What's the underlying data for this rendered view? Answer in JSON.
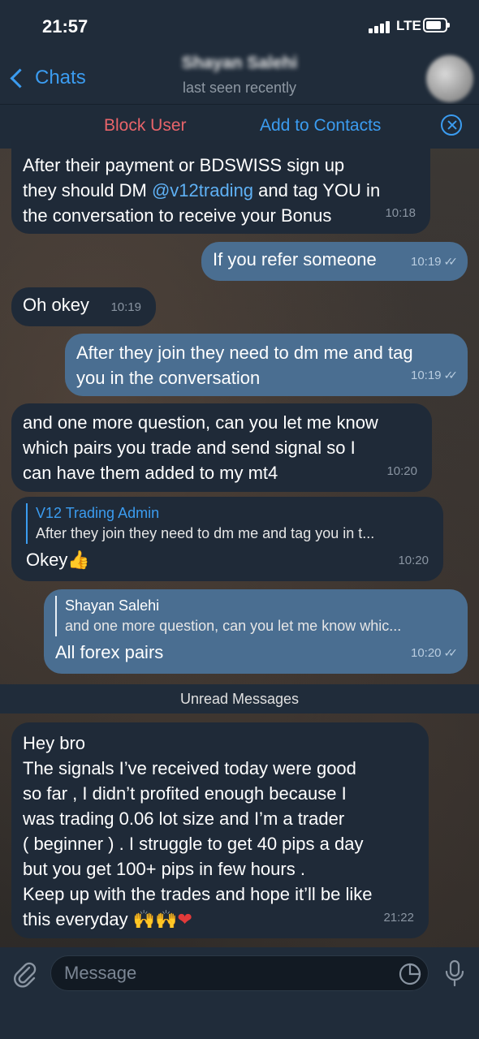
{
  "status_bar": {
    "time": "21:57",
    "network": "LTE"
  },
  "nav": {
    "back_label": "Chats",
    "contact_name": "Shayan Salehi",
    "last_seen": "last seen recently"
  },
  "action_bar": {
    "block_label": "Block User",
    "add_label": "Add to Contacts"
  },
  "messages": [
    {
      "dir": "in",
      "text_before": "After their payment or BDSWISS sign up\nthey should DM ",
      "link": "@v12trading",
      "text_after": " and tag YOU in\nthe conversation to receive your Bonus",
      "time": "10:18"
    },
    {
      "dir": "out",
      "text": "If you refer someone",
      "time": "10:19"
    },
    {
      "dir": "in",
      "text": "Oh okey",
      "time": "10:19"
    },
    {
      "dir": "out",
      "text": "After they join they need to dm me and tag\nyou in the conversation",
      "time": "10:19"
    },
    {
      "dir": "in",
      "text": "and one more question, can you let me know\nwhich pairs you trade and send signal so I\ncan have them added to my mt4",
      "time": "10:20"
    },
    {
      "dir": "in",
      "reply_name": "V12 Trading Admin",
      "reply_text": "After they join they need to dm me and tag you in t...",
      "text": "Okey",
      "emoji": "👍",
      "time": "10:20"
    },
    {
      "dir": "out",
      "reply_name": "Shayan Salehi",
      "reply_text": "and one more question, can you let me know whic...",
      "text": "All forex pairs",
      "time": "10:20"
    },
    {
      "dir": "in",
      "text": "Hey bro\nThe signals I’ve received today were good\nso far , I didn’t profited enough because I\nwas trading 0.06 lot size and I’m a trader\n( beginner ) . I struggle to get 40 pips a day\nbut you get 100+ pips in few hours .\nKeep up with the trades and hope it’ll be like\nthis everyday ",
      "emoji": "🙌🙌",
      "emoji2": "❤",
      "time": "21:22"
    }
  ],
  "unread_label": "Unread Messages",
  "composer": {
    "placeholder": "Message"
  },
  "icons": {
    "back": "chevron-left-icon",
    "close": "close-circle-icon",
    "attach": "paperclip-icon",
    "sticker": "sticker-icon",
    "mic": "microphone-icon",
    "read": "double-check-icon"
  },
  "colors": {
    "accent": "#3b9cf0",
    "danger": "#e8646a",
    "outgoing": "#4a6e91",
    "incoming": "#1f2a38"
  }
}
